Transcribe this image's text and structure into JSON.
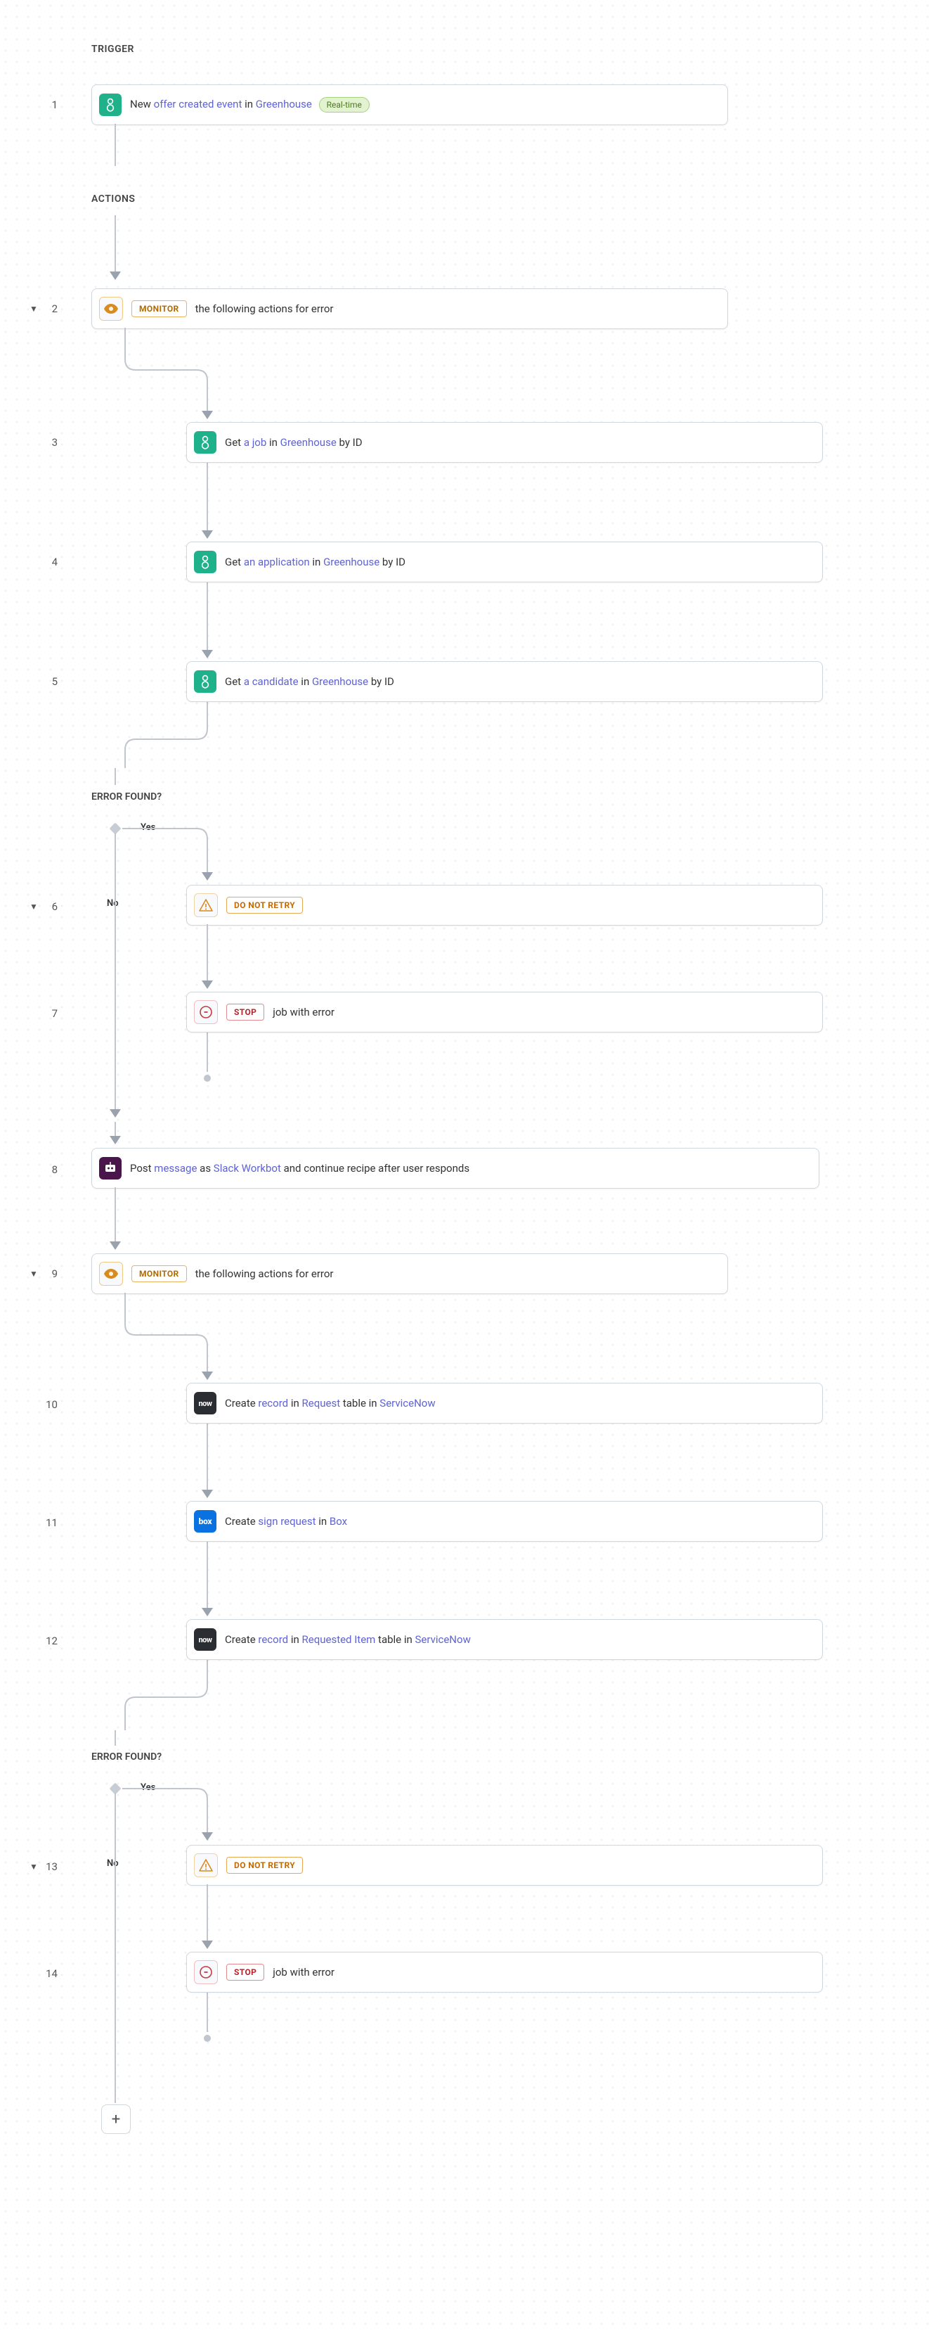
{
  "sections": {
    "trigger": "TRIGGER",
    "actions": "ACTIONS",
    "error1": "ERROR FOUND?",
    "error2": "ERROR FOUND?"
  },
  "labels": {
    "yes": "Yes",
    "no": "No",
    "realtime": "Real-time",
    "monitor": "MONITOR",
    "dnr": "DO NOT RETRY",
    "stop": "STOP",
    "monitor_suffix": "the following actions for error",
    "stop_suffix": "job with error"
  },
  "steps": {
    "1": {
      "num": "1",
      "parts": [
        "New ",
        "offer created event",
        " in ",
        "Greenhouse"
      ]
    },
    "2": {
      "num": "2"
    },
    "3": {
      "num": "3",
      "parts": [
        "Get ",
        "a job",
        " in ",
        "Greenhouse",
        " by ID"
      ]
    },
    "4": {
      "num": "4",
      "parts": [
        "Get ",
        "an application",
        " in ",
        "Greenhouse",
        " by ID"
      ]
    },
    "5": {
      "num": "5",
      "parts": [
        "Get ",
        "a candidate",
        " in ",
        "Greenhouse",
        " by ID"
      ]
    },
    "6": {
      "num": "6"
    },
    "7": {
      "num": "7"
    },
    "8": {
      "num": "8",
      "parts": [
        "Post ",
        "message",
        " as ",
        "Slack Workbot",
        " and continue recipe after user responds"
      ]
    },
    "9": {
      "num": "9"
    },
    "10": {
      "num": "10",
      "parts": [
        "Create ",
        "record",
        " in ",
        "Request",
        " table in ",
        "ServiceNow"
      ]
    },
    "11": {
      "num": "11",
      "parts": [
        "Create ",
        "sign request",
        " in ",
        "Box"
      ]
    },
    "12": {
      "num": "12",
      "parts": [
        "Create ",
        "record",
        " in ",
        "Requested Item",
        " table in ",
        "ServiceNow"
      ]
    },
    "13": {
      "num": "13"
    },
    "14": {
      "num": "14"
    }
  }
}
